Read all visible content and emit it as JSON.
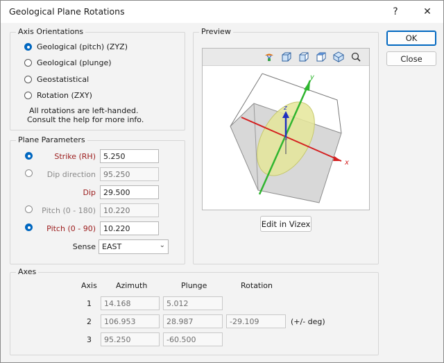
{
  "window": {
    "title": "Geological Plane Rotations",
    "help_label": "?",
    "close_label": "✕"
  },
  "axis_orientations": {
    "label": "Axis Orientations",
    "options": [
      {
        "label": "Geological (pitch) (ZYZ)",
        "selected": true
      },
      {
        "label": "Geological (plunge)",
        "selected": false
      },
      {
        "label": "Geostatistical",
        "selected": false
      },
      {
        "label": "Rotation (ZXY)",
        "selected": false
      }
    ],
    "note_line1": "All rotations are left-handed.",
    "note_line2": "Consult the help for more info."
  },
  "plane_parameters": {
    "label": "Plane Parameters",
    "strike_label": "Strike (RH)",
    "strike_value": "5.250",
    "dip_direction_label": "Dip direction",
    "dip_direction_value": "95.250",
    "dip_label": "Dip",
    "dip_value": "29.500",
    "pitch180_label": "Pitch (0 - 180)",
    "pitch180_value": "10.220",
    "pitch90_label": "Pitch (0 - 90)",
    "pitch90_value": "10.220",
    "sense_label": "Sense",
    "sense_value": "EAST"
  },
  "preview": {
    "label": "Preview",
    "toolbar_icons": [
      "palette-icon",
      "cube-view-1-icon",
      "cube-view-2-icon",
      "cube-view-3-icon",
      "cube-view-4-icon",
      "zoom-icon"
    ],
    "axis_x": "x",
    "axis_y": "y",
    "axis_z": "z",
    "edit_button": "Edit in Vizex"
  },
  "buttons": {
    "ok": "OK",
    "close": "Close"
  },
  "axes": {
    "label": "Axes",
    "headers": {
      "axis": "Axis",
      "azimuth": "Azimuth",
      "plunge": "Plunge",
      "rotation": "Rotation"
    },
    "rows": [
      {
        "axis": "1",
        "azimuth": "14.168",
        "plunge": "5.012"
      },
      {
        "axis": "2",
        "azimuth": "106.953",
        "plunge": "28.987",
        "rotation": "-29.109"
      },
      {
        "axis": "3",
        "azimuth": "95.250",
        "plunge": "-60.500"
      }
    ],
    "deg_note": "(+/- deg)"
  },
  "colors": {
    "accent": "#0067c0",
    "required_label": "#9b1b1b",
    "x_axis": "#d42020",
    "y_axis": "#2fb52f",
    "z_axis": "#2030c0",
    "plane": "#e5e69a"
  }
}
